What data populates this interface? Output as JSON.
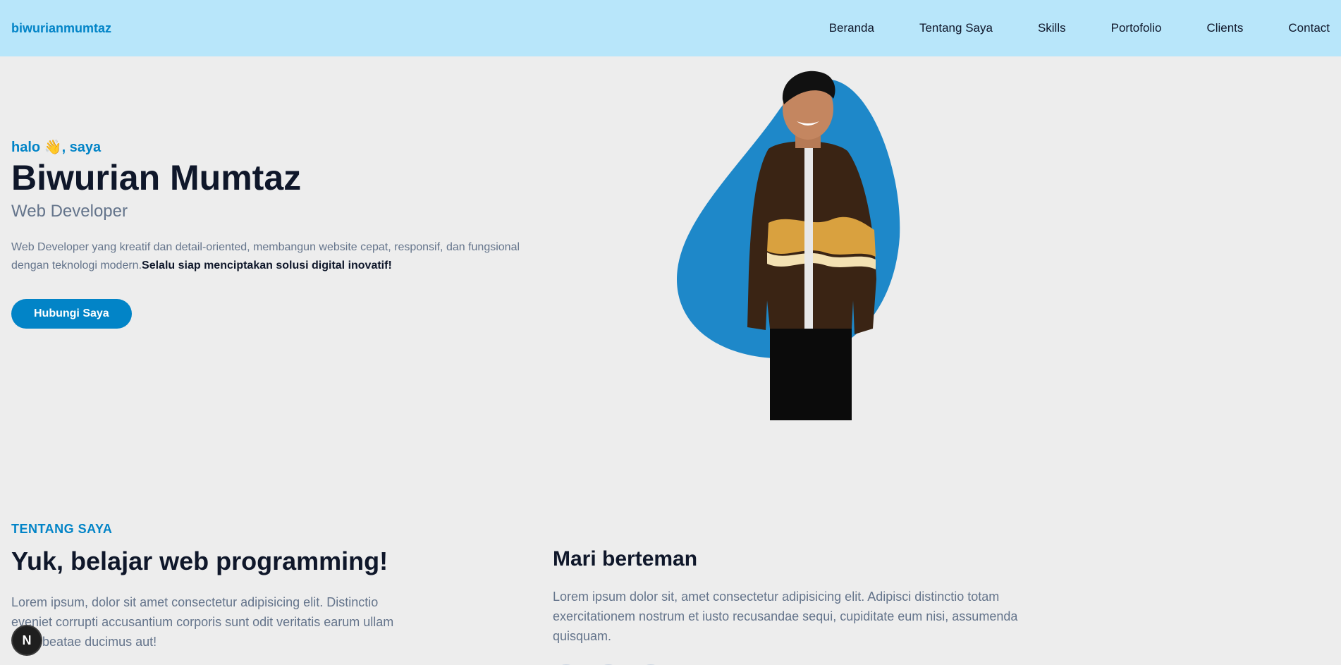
{
  "navbar": {
    "brand": "biwurianmumtaz",
    "links": [
      "Beranda",
      "Tentang Saya",
      "Skills",
      "Portofolio",
      "Clients",
      "Contact"
    ]
  },
  "hero": {
    "greeting": "halo 👋, saya",
    "name": "Biwurian Mumtaz",
    "role": "Web Developer",
    "description": "Web Developer yang kreatif dan detail-oriented, membangun website cepat, responsif, dan fungsional dengan teknologi modern.",
    "description_bold": "Selalu siap menciptakan solusi digital inovatif!",
    "cta_label": "Hubungi Saya"
  },
  "about": {
    "section_label": "TENTANG SAYA",
    "title": "Yuk, belajar web programming!",
    "text": "Lorem ipsum, dolor sit amet consectetur adipisicing elit. Distinctio eveniet corrupti accusantium corporis sunt odit veritatis earum ullam quos beatae ducimus aut!",
    "friends_title": "Mari berteman",
    "friends_text": "Lorem ipsum dolor sit, amet consectetur adipisicing elit. Adipisci distinctio totam exercitationem nostrum et iusto recusandae sequi, cupiditate eum nisi, assumenda quisquam."
  },
  "badge": {
    "letter": "N"
  },
  "colors": {
    "navbar_bg": "#b8e6fa",
    "accent": "#0284c7",
    "blob": "#1e88c9",
    "page_bg": "#ededed"
  }
}
